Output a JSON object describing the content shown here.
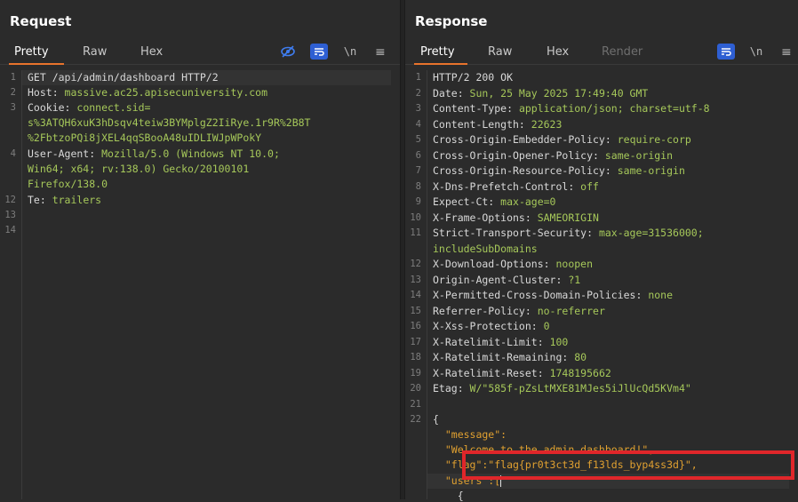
{
  "request": {
    "title": "Request",
    "tabs": [
      "Pretty",
      "Raw",
      "Hex"
    ],
    "toolbar": {
      "newline_label": "\\n"
    },
    "line_numbers": [
      "1",
      "2",
      "3",
      "4",
      "12",
      "13",
      "14"
    ],
    "lines": [
      {
        "text": "GET /api/admin/dashboard HTTP/2"
      },
      {
        "key": "Host: ",
        "value": "massive.ac25.apisecuniversity.com"
      },
      {
        "key": "Cookie: ",
        "value": "connect.sid="
      },
      {
        "value": "s%3ATQH6xuK3hDsqv4teiw3BYMplgZ2IiRye.1r9R%2B8T"
      },
      {
        "value": "%2FbtzoPQi8jXEL4qqSBooA48uIDLIWJpWPokY"
      },
      {
        "key": "User-Agent: ",
        "value": "Mozilla/5.0 (Windows NT 10.0;"
      },
      {
        "value": "Win64; x64; rv:138.0) Gecko/20100101"
      },
      {
        "value": "Firefox/138.0"
      },
      {
        "key": "Te: ",
        "value": "trailers"
      }
    ]
  },
  "response": {
    "title": "Response",
    "tabs": [
      "Pretty",
      "Raw",
      "Hex",
      "Render"
    ],
    "toolbar": {
      "newline_label": "\\n"
    },
    "line_numbers": [
      "1",
      "2",
      "3",
      "4",
      "5",
      "6",
      "7",
      "8",
      "9",
      "10",
      "11",
      "12",
      "13",
      "14",
      "15",
      "16",
      "17",
      "18",
      "19",
      "20",
      "21",
      "22"
    ],
    "lines": [
      {
        "text": "HTTP/2 200 OK"
      },
      {
        "key": "Date: ",
        "value": "Sun, 25 May 2025 17:49:40 GMT"
      },
      {
        "key": "Content-Type: ",
        "value": "application/json; charset=utf-8"
      },
      {
        "key": "Content-Length: ",
        "value": "22623"
      },
      {
        "key": "Cross-Origin-Embedder-Policy: ",
        "value": "require-corp"
      },
      {
        "key": "Cross-Origin-Opener-Policy: ",
        "value": "same-origin"
      },
      {
        "key": "Cross-Origin-Resource-Policy: ",
        "value": "same-origin"
      },
      {
        "key": "X-Dns-Prefetch-Control: ",
        "value": "off"
      },
      {
        "key": "Expect-Ct: ",
        "value": "max-age=0"
      },
      {
        "key": "X-Frame-Options: ",
        "value": "SAMEORIGIN"
      },
      {
        "key": "Strict-Transport-Security: ",
        "value": "max-age=31536000;"
      },
      {
        "value": "includeSubDomains"
      },
      {
        "key": "X-Download-Options: ",
        "value": "noopen"
      },
      {
        "key": "Origin-Agent-Cluster: ",
        "value": "?1"
      },
      {
        "key": "X-Permitted-Cross-Domain-Policies: ",
        "value": "none"
      },
      {
        "key": "Referrer-Policy: ",
        "value": "no-referrer"
      },
      {
        "key": "X-Xss-Protection: ",
        "value": "0"
      },
      {
        "key": "X-Ratelimit-Limit: ",
        "value": "100"
      },
      {
        "key": "X-Ratelimit-Remaining: ",
        "value": "80"
      },
      {
        "key": "X-Ratelimit-Reset: ",
        "value": "1748195662"
      },
      {
        "key": "Etag: ",
        "value": "W/\"585f-pZsLtMXE81MJes5iJlUcQd5KVm4\""
      },
      {
        "text": ""
      },
      {
        "text": "{"
      },
      {
        "text": "  \"message\":"
      },
      {
        "text": "  \"Welcome to the admin dashboard!\","
      },
      {
        "text": "  \"flag\":\"flag{pr0t3ct3d_f13lds_byp4ss3d}\","
      },
      {
        "text": "  \"users\":["
      },
      {
        "text": "    {"
      }
    ]
  },
  "colors": {
    "accent": "#e8732c",
    "blue_button": "#2e5fd3",
    "highlight_box": "#e0262a",
    "header_value": "#a6c85a",
    "json": "#e0a030"
  }
}
